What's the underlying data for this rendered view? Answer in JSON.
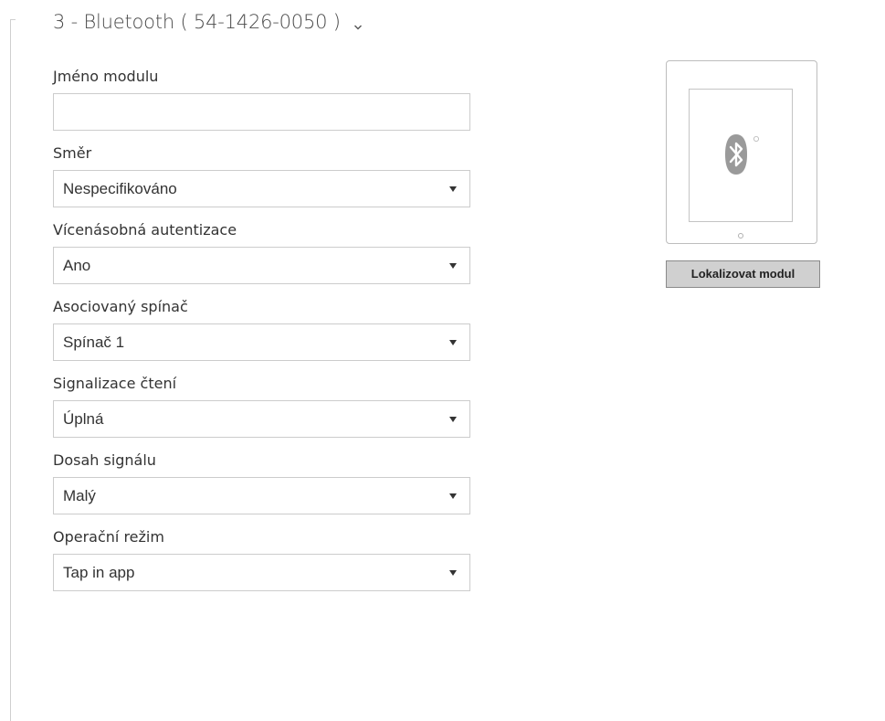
{
  "section": {
    "title": "3 - Bluetooth ( 54-1426-0050 )",
    "expand_icon": "chevron-down-icon"
  },
  "form": {
    "module_name": {
      "label": "Jméno modulu",
      "value": ""
    },
    "direction": {
      "label": "Směr",
      "value": "Nespecifikováno"
    },
    "multi_auth": {
      "label": "Vícenásobná autentizace",
      "value": "Ano"
    },
    "associated_switch": {
      "label": "Asociovaný spínač",
      "value": "Spínač 1"
    },
    "read_signalling": {
      "label": "Signalizace čtení",
      "value": "Úplná"
    },
    "signal_range": {
      "label": "Dosah signálu",
      "value": "Malý"
    },
    "operation_mode": {
      "label": "Operační režim",
      "value": "Tap in app"
    }
  },
  "module_preview": {
    "icon": "bluetooth-icon",
    "icon_color": "#9a9a9a",
    "locate_button_label": "Lokalizovat modul"
  }
}
